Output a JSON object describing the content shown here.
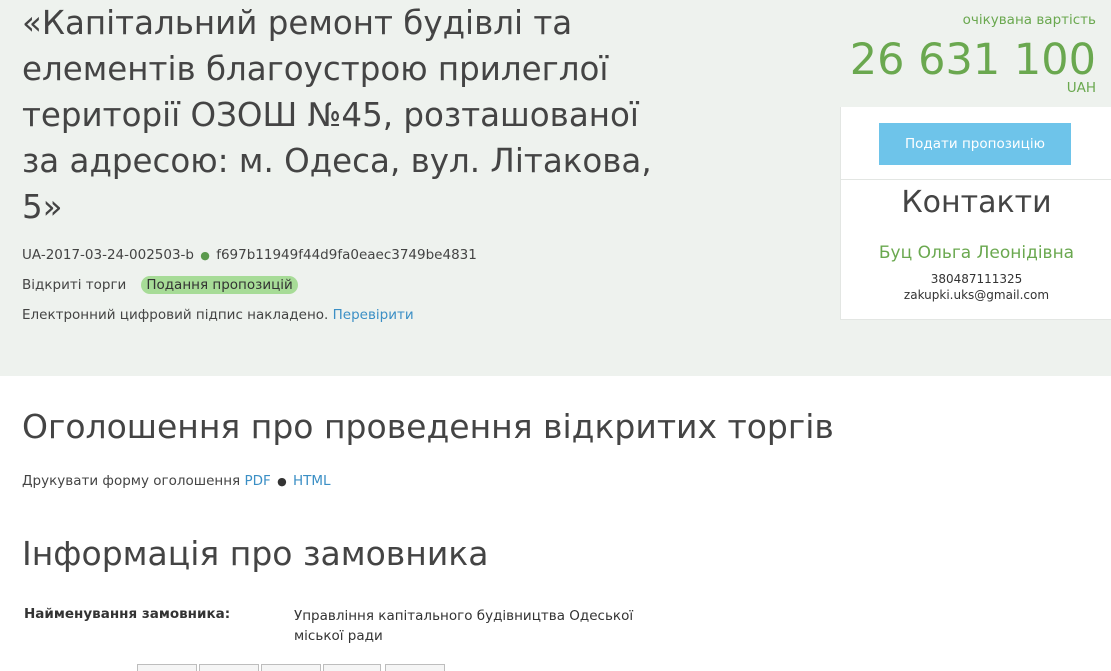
{
  "tender": {
    "title": "«Капітальний ремонт будівлі та елементів благоустрою прилеглої території ОЗОШ №45, розташованої за адресою: м. Одеса, вул. Літакова, 5»",
    "id": "UA-2017-03-24-002503-b",
    "separator": "●",
    "hash": "f697b11949f44d9fa0eaec3749be4831",
    "procedure_type": "Відкриті торги",
    "status": "Подання пропозицій",
    "signature_text": "Електронний цифровий підпис накладено.",
    "verify_link": "Перевірити"
  },
  "value": {
    "label": "очікувана вартість",
    "amount": "26 631 100",
    "currency": "UAH"
  },
  "sidebar": {
    "bid_button": "Подати пропозицію",
    "contacts_title": "Контакти",
    "contact_name": "Буц Ольга Леонідівна",
    "phone": "380487111325",
    "email": "zakupki.uks@gmail.com"
  },
  "announcement": {
    "heading": "Оголошення про проведення відкритих торгів",
    "print_label": "Друкувати форму оголошення",
    "pdf_link": "PDF",
    "separator": "●",
    "html_link": "HTML"
  },
  "customer": {
    "heading": "Інформація про замовника",
    "name_label": "Найменування замовника:",
    "name_value": "Управління капітального будівництва Одеської міської ради"
  },
  "colors": {
    "header_bg": "#eef2ee",
    "accent_green": "#6aa84f",
    "badge_green": "#a7dc97",
    "button_blue": "#6ec4ea",
    "link_blue": "#3b8fc5"
  }
}
